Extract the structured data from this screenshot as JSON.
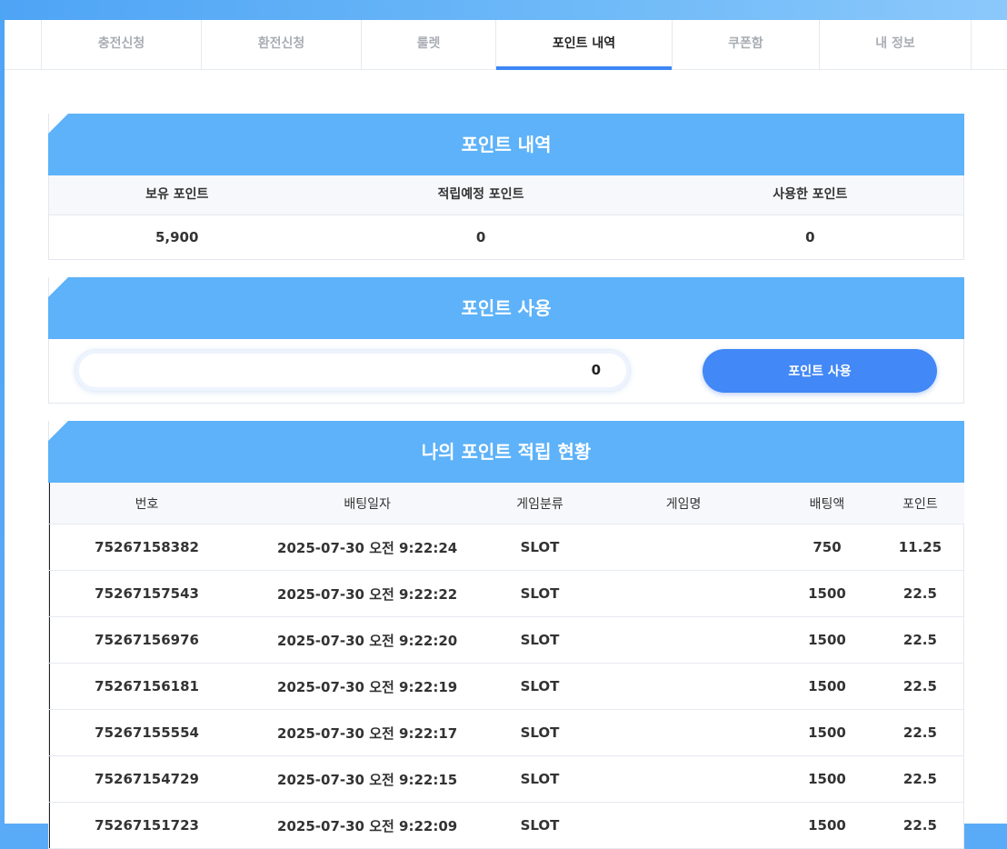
{
  "tabs": [
    {
      "label": "충전신청",
      "active": false
    },
    {
      "label": "환전신청",
      "active": false
    },
    {
      "label": "룰렛",
      "active": false
    },
    {
      "label": "포인트 내역",
      "active": true
    },
    {
      "label": "쿠폰함",
      "active": false
    },
    {
      "label": "내 정보",
      "active": false
    }
  ],
  "summary": {
    "title": "포인트 내역",
    "headers": [
      "보유 포인트",
      "적립예정 포인트",
      "사용한 포인트"
    ],
    "values": [
      "5,900",
      "0",
      "0"
    ]
  },
  "use": {
    "title": "포인트 사용",
    "input_value": "0",
    "button_label": "포인트 사용"
  },
  "history": {
    "title": "나의 포인트 적립 현황",
    "headers": [
      "번호",
      "배팅일자",
      "게임분류",
      "게임명",
      "배팅액",
      "포인트"
    ],
    "rows": [
      [
        "75267158382",
        "2025-07-30 오전 9:22:24",
        "SLOT",
        "",
        "750",
        "11.25"
      ],
      [
        "75267157543",
        "2025-07-30 오전 9:22:22",
        "SLOT",
        "",
        "1500",
        "22.5"
      ],
      [
        "75267156976",
        "2025-07-30 오전 9:22:20",
        "SLOT",
        "",
        "1500",
        "22.5"
      ],
      [
        "75267156181",
        "2025-07-30 오전 9:22:19",
        "SLOT",
        "",
        "1500",
        "22.5"
      ],
      [
        "75267155554",
        "2025-07-30 오전 9:22:17",
        "SLOT",
        "",
        "1500",
        "22.5"
      ],
      [
        "75267154729",
        "2025-07-30 오전 9:22:15",
        "SLOT",
        "",
        "1500",
        "22.5"
      ],
      [
        "75267151723",
        "2025-07-30 오전 9:22:09",
        "SLOT",
        "",
        "1500",
        "22.5"
      ]
    ]
  },
  "colors": {
    "accent": "#3d86f5",
    "header_blue": "#5db2f9",
    "button_blue": "#4288f6"
  }
}
